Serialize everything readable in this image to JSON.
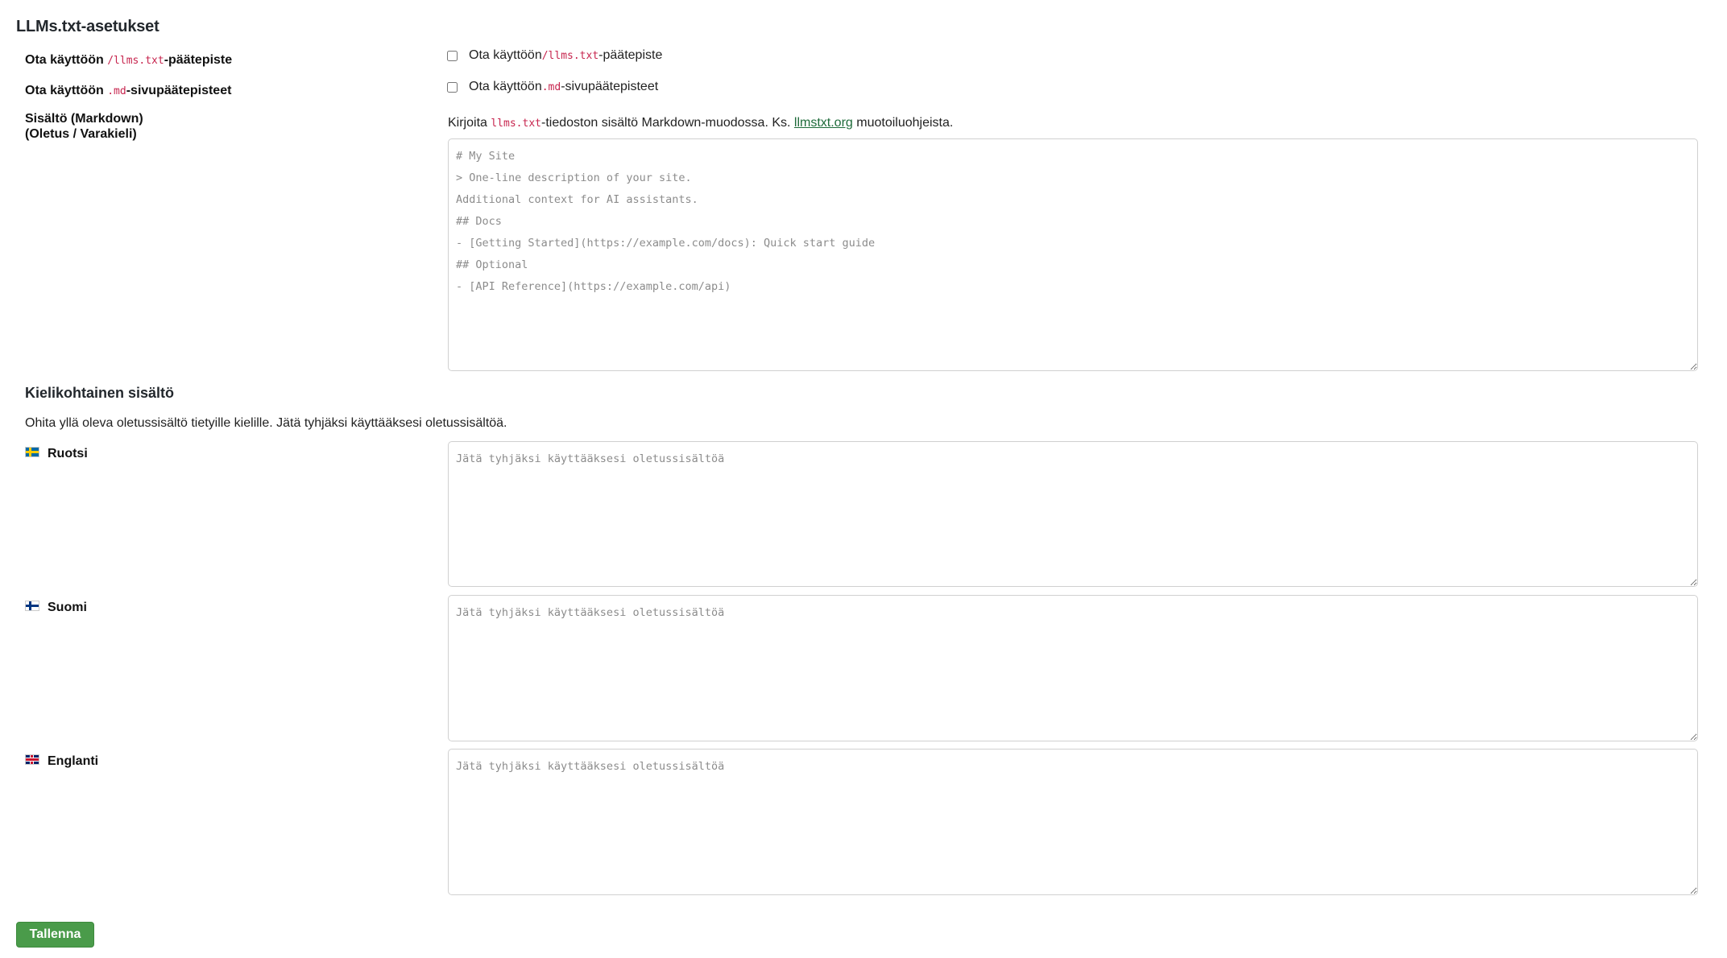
{
  "page": {
    "title": "LLMs.txt-asetukset"
  },
  "settings": {
    "llms_endpoint": {
      "label_prefix": "Ota käyttöön ",
      "label_code": "/llms.txt",
      "label_suffix": "-päätepiste",
      "checkbox_prefix": "Ota käyttöön ",
      "checkbox_code": "/llms.txt",
      "checkbox_suffix": "-päätepiste",
      "checked": false
    },
    "md_endpoints": {
      "label_prefix": "Ota käyttöön ",
      "label_code": ".md",
      "label_suffix": "-sivupäätepisteet",
      "checkbox_prefix": "Ota käyttöön ",
      "checkbox_code": ".md",
      "checkbox_suffix": "-sivupäätepisteet",
      "checked": false
    },
    "content": {
      "label_line1": "Sisältö (Markdown)",
      "label_line2": "(Oletus / Varakieli)",
      "desc_prefix": "Kirjoita ",
      "desc_code": "llms.txt",
      "desc_middle": "-tiedoston sisältö Markdown-muodossa. Ks. ",
      "desc_link": "llmstxt.org",
      "desc_suffix": " muotoiluohjeista.",
      "placeholder": "# My Site\n> One-line description of your site.\nAdditional context for AI assistants.\n## Docs\n- [Getting Started](https://example.com/docs): Quick start guide\n## Optional\n- [API Reference](https://example.com/api)"
    }
  },
  "language_section": {
    "title": "Kielikohtainen sisältö",
    "description": "Ohita yllä oleva oletussisältö tietyille kielille. Jätä tyhjäksi käyttääksesi oletussisältöä.",
    "languages": [
      {
        "name": "Ruotsi",
        "flag_icon": "flag-sweden-icon",
        "placeholder": "Jätä tyhjäksi käyttääksesi oletussisältöä"
      },
      {
        "name": "Suomi",
        "flag_icon": "flag-finland-icon",
        "placeholder": "Jätä tyhjäksi käyttääksesi oletussisältöä"
      },
      {
        "name": "Englanti",
        "flag_icon": "flag-uk-icon",
        "placeholder": "Jätä tyhjäksi käyttääksesi oletussisältöä"
      }
    ]
  },
  "save_button": {
    "label": "Tallenna"
  },
  "colors": {
    "accent": "#4a9b4a",
    "code": "#c7254e",
    "link": "#1e6b3a"
  }
}
